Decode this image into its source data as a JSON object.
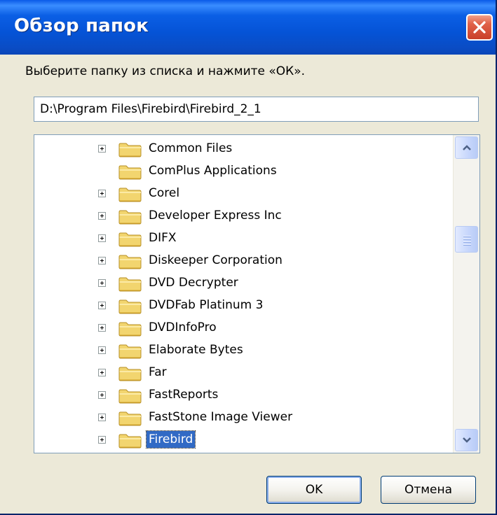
{
  "window": {
    "title": "Обзор папок"
  },
  "prompt": "Выберите папку из списка и нажмите «ОК».",
  "path_value": "D:\\Program Files\\Firebird\\Firebird_2_1",
  "folders": [
    {
      "label": "Common Files",
      "expandable": true,
      "selected": false
    },
    {
      "label": "ComPlus Applications",
      "expandable": false,
      "selected": false
    },
    {
      "label": "Corel",
      "expandable": true,
      "selected": false
    },
    {
      "label": "Developer Express Inc",
      "expandable": true,
      "selected": false
    },
    {
      "label": "DIFX",
      "expandable": true,
      "selected": false
    },
    {
      "label": "Diskeeper Corporation",
      "expandable": true,
      "selected": false
    },
    {
      "label": "DVD Decrypter",
      "expandable": true,
      "selected": false
    },
    {
      "label": "DVDFab Platinum 3",
      "expandable": true,
      "selected": false
    },
    {
      "label": "DVDInfoPro",
      "expandable": true,
      "selected": false
    },
    {
      "label": "Elaborate Bytes",
      "expandable": true,
      "selected": false
    },
    {
      "label": "Far",
      "expandable": true,
      "selected": false
    },
    {
      "label": "FastReports",
      "expandable": true,
      "selected": false
    },
    {
      "label": "FastStone Image Viewer",
      "expandable": true,
      "selected": false
    },
    {
      "label": "Firebird",
      "expandable": true,
      "selected": true
    }
  ],
  "buttons": {
    "ok": "OK",
    "cancel": "Отмена"
  },
  "colors": {
    "selection": "#316ac5",
    "titlebar": "#0553d6",
    "close": "#e1624a"
  },
  "icons": {
    "folder": "folder-icon",
    "expand": "plus-box-icon",
    "close": "close-icon"
  }
}
